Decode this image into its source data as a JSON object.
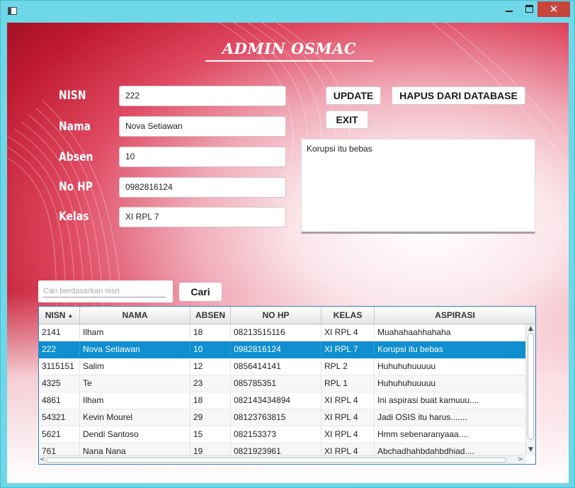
{
  "window": {
    "controls": {
      "minimize": "",
      "maximize": "",
      "close": "✕"
    }
  },
  "form": {
    "title": "ADMIN OSMAC",
    "labels": {
      "nisn": "NISN",
      "nama": "Nama",
      "absen": "Absen",
      "no_hp": "No HP",
      "kelas": "Kelas"
    },
    "values": {
      "nisn": "222",
      "nama": "Nova Setiawan",
      "absen": "10",
      "no_hp": "0982816124",
      "kelas": "XI RPL 7"
    },
    "aspirasi": "Korupsi itu bebas"
  },
  "buttons": {
    "update": "UPDATE",
    "hapus": "HAPUS DARI DATABASE",
    "exit": "EXIT",
    "cari": "Cari"
  },
  "search": {
    "placeholder": "Cari berdasarkan nisn"
  },
  "table": {
    "sort_indicator": "▲",
    "columns": [
      "NISN",
      "NAMA",
      "ABSEN",
      "NO HP",
      "KELAS",
      "ASPIRASI"
    ],
    "rows": [
      [
        "2141",
        "Ilham",
        "18",
        "08213515116",
        "XI RPL 4",
        "Muahahaahhahaha"
      ],
      [
        "222",
        "Nova Setiawan",
        "10",
        "0982816124",
        "XI RPL 7",
        "Korupsi itu bebas"
      ],
      [
        "3115151",
        "Salim",
        "12",
        "0856414141",
        "RPL 2",
        "Huhuhuhuuuuu"
      ],
      [
        "4325",
        "Te",
        "23",
        "085785351",
        "RPL 1",
        "Huhuhuhuuuuu"
      ],
      [
        "4861",
        "Ilham",
        "18",
        "082143434894",
        "XI RPL 4",
        "Ini aspirasi buat kamuuu...."
      ],
      [
        "54321",
        "Kevin Mourel",
        "29",
        "08123763815",
        "XI RPL 4",
        "Jadi OSIS itu harus......."
      ],
      [
        "5621",
        "Dendi Santoso",
        "15",
        "082153373",
        "XI RPL 4",
        "Hmm sebenaranyaaa...."
      ],
      [
        "761",
        "Nana Nana",
        "19",
        "0821923961",
        "XI RPL 4",
        "Abchadhahbdahbdhiad...."
      ]
    ],
    "selected_row": 1
  },
  "scrollbar_glyphs": {
    "up": "▲",
    "down": "▼",
    "left": "<",
    "right": ">"
  }
}
